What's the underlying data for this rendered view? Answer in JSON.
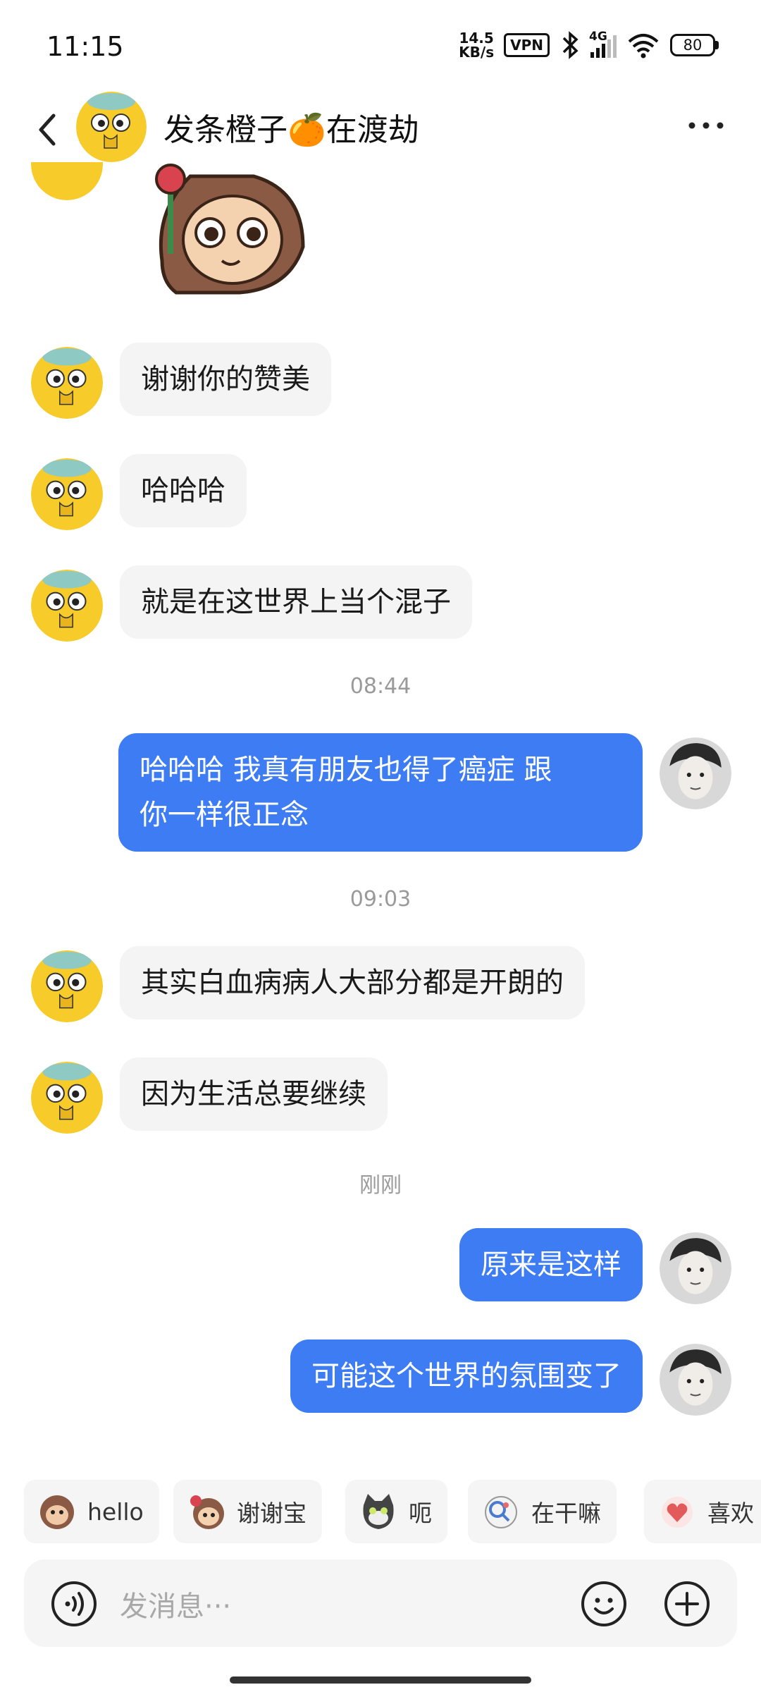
{
  "status_bar": {
    "time": "11:15",
    "net_speed_value": "14.5",
    "net_speed_unit": "KB/s",
    "vpn": "VPN",
    "signal": "4G",
    "battery": "80"
  },
  "header": {
    "title": "发条橙子🍊在渡劫"
  },
  "messages": [
    {
      "side": "in",
      "text": "谢谢你的赞美"
    },
    {
      "side": "in",
      "text": "哈哈哈"
    },
    {
      "side": "in",
      "text": "就是在这世界上当个混子"
    },
    {
      "time": "08:44"
    },
    {
      "side": "out",
      "line1": "哈哈哈 我真有朋友也得了癌症 跟",
      "line2": "你一样很正念"
    },
    {
      "time": "09:03"
    },
    {
      "side": "in",
      "text": "其实白血病病人大部分都是开朗的"
    },
    {
      "side": "in",
      "text": "因为生活总要继续"
    },
    {
      "time": "刚刚"
    },
    {
      "side": "out",
      "text": "原来是这样"
    },
    {
      "side": "out",
      "text": "可能这个世界的氛围变了"
    }
  ],
  "quick_replies": [
    "hello",
    "谢谢宝",
    "呃",
    "在干嘛",
    "喜欢"
  ],
  "input": {
    "placeholder": "发消息···"
  },
  "colors": {
    "accent": "#3d7cf2",
    "bubble_in": "#f4f4f4"
  }
}
